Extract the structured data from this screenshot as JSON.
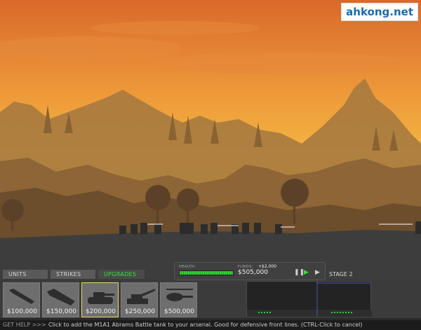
{
  "watermark": "ahkong.net",
  "tabs": [
    {
      "label": "UNITS",
      "active": false
    },
    {
      "label": "STRIKES",
      "active": false
    },
    {
      "label": "UPGRADES",
      "active": true
    }
  ],
  "arsenal": [
    {
      "icon": "missile-icon",
      "price": "$100,000",
      "selected": false
    },
    {
      "icon": "rocket-launcher-icon",
      "price": "$150,000",
      "selected": false
    },
    {
      "icon": "tank-icon",
      "price": "$200,000",
      "selected": true
    },
    {
      "icon": "artillery-icon",
      "price": "$250,000",
      "selected": false
    },
    {
      "icon": "helicopter-icon",
      "price": "$500,000",
      "selected": false
    }
  ],
  "hud": {
    "health_label": "HEALTH:",
    "health_fraction": 1.0,
    "funds_label": "FUNDS:",
    "funds_delta": "+$2,000",
    "funds_value": "$505,000",
    "stage": "STAGE 2"
  },
  "help": {
    "get_help": "GET HELP >>>",
    "message": "Click to add the M1A1 Abrams Battle tank to your arsenal. Good for defensive front lines. (CTRL-Click to cancel)"
  },
  "colors": {
    "sky_top": "#e3742a",
    "sky_bottom": "#f6cc47",
    "ground": "#3d3d3d",
    "accent_green": "#35e23a"
  }
}
